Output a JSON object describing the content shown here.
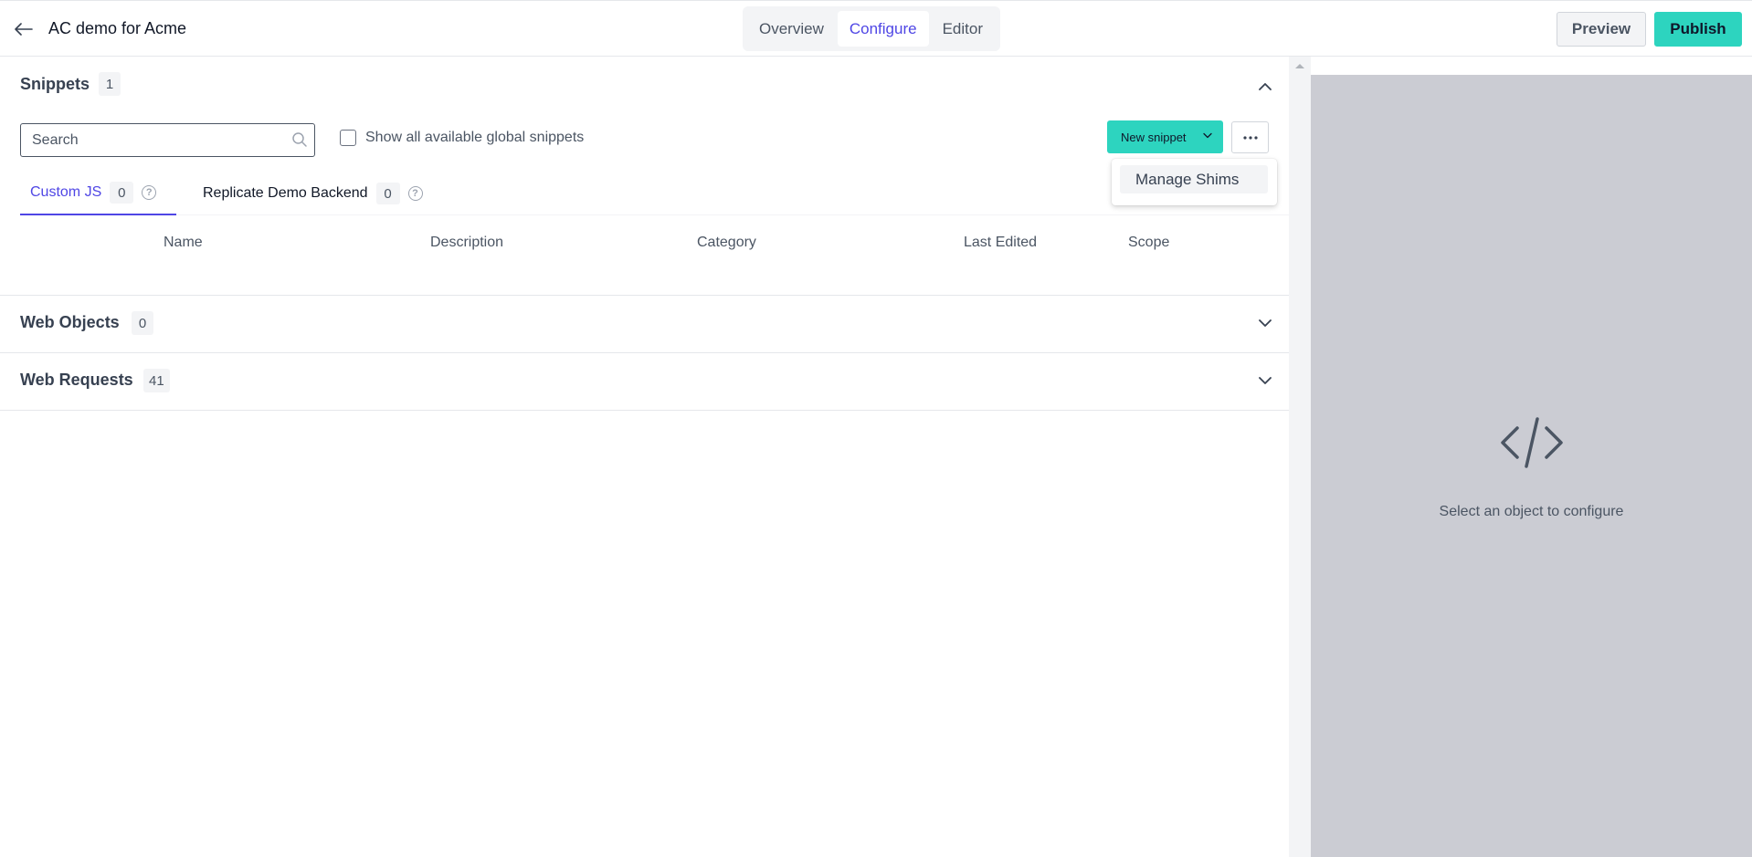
{
  "header": {
    "title": "AC demo for Acme",
    "tabs": [
      {
        "label": "Overview",
        "active": false
      },
      {
        "label": "Configure",
        "active": true
      },
      {
        "label": "Editor",
        "active": false
      }
    ],
    "preview_label": "Preview",
    "publish_label": "Publish"
  },
  "snippets": {
    "title": "Snippets",
    "count": "1",
    "search_placeholder": "Search",
    "show_global_label": "Show all available global snippets",
    "new_snippet_label": "New snippet",
    "menu": {
      "items": [
        "Manage Shims"
      ]
    },
    "subtabs": [
      {
        "label": "Custom JS",
        "count": "0"
      },
      {
        "label": "Replicate Demo Backend",
        "count": "0"
      }
    ],
    "columns": [
      "Name",
      "Description",
      "Category",
      "Last Edited",
      "Scope"
    ]
  },
  "web_objects": {
    "title": "Web Objects",
    "count": "0"
  },
  "web_requests": {
    "title": "Web Requests",
    "count": "41"
  },
  "right_panel": {
    "empty_text": "Select an object to configure"
  },
  "colors": {
    "accent": "#4f46e5",
    "primary_button": "#2dd4bf",
    "panel_bg": "#cbccd3"
  },
  "icons": [
    "arrow-left-icon",
    "search-icon",
    "chevron-down-icon",
    "chevron-up-icon",
    "more-horizontal-icon",
    "help-circle-icon",
    "code-icon"
  ]
}
